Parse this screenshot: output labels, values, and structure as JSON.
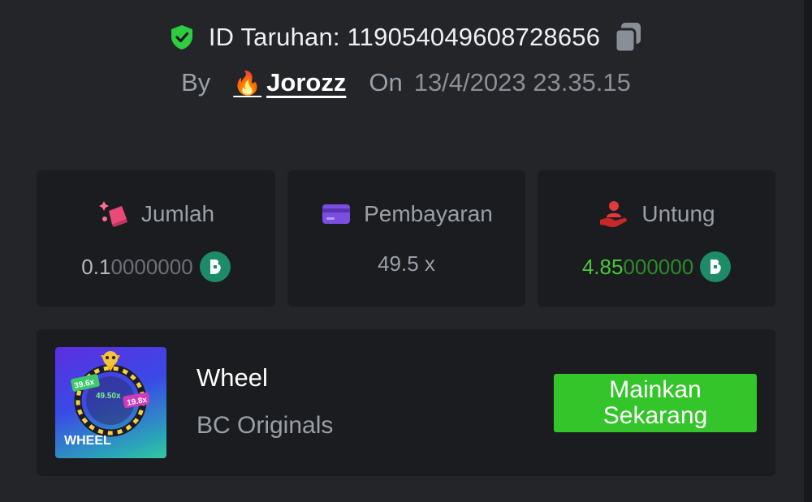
{
  "header": {
    "bet_id_label": "ID Taruhan:",
    "bet_id": "119054049608728656",
    "by_label": "By",
    "username": "Jorozz",
    "on_label": "On",
    "date": "13/4/2023 23.35.15"
  },
  "cards": {
    "amount": {
      "label": "Jumlah",
      "value_lead": "0.1",
      "value_tail": "0000000",
      "icon": "money-bag-icon"
    },
    "payout": {
      "label": "Pembayaran",
      "value": "49.5 x",
      "icon": "card-icon"
    },
    "profit": {
      "label": "Untung",
      "value_lead": "4.85",
      "value_tail": "000000",
      "icon": "hand-user-icon"
    }
  },
  "game": {
    "title": "Wheel",
    "provider": "BC Originals",
    "play_label": "Mainkan\nSekarang",
    "thumb": {
      "brand": "WHEEL",
      "mult_a": "39.6x",
      "mult_center": "49.50x",
      "mult_b": "19.8x"
    }
  },
  "colors": {
    "background": "#232529",
    "card": "#1a1c1f",
    "accent_green": "#34c52a",
    "profit_green": "#48c93a",
    "shield_green": "#2ecc40",
    "coin": "#1d8b67"
  }
}
